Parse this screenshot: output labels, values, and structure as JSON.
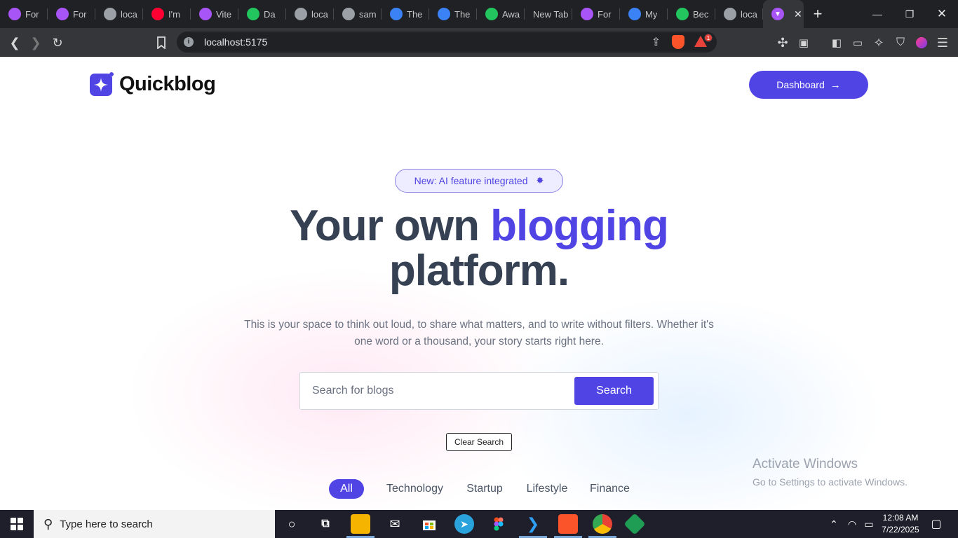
{
  "browser": {
    "tabs": [
      {
        "label": "For",
        "icon": "vite-icon",
        "color": "#a855f7"
      },
      {
        "label": "For",
        "icon": "vite-icon",
        "color": "#a855f7"
      },
      {
        "label": "loca",
        "icon": "globe-icon",
        "color": "#9aa0a6"
      },
      {
        "label": "I'm",
        "icon": "youtube-icon",
        "color": "#ff0033"
      },
      {
        "label": "Vite",
        "icon": "vite-icon",
        "color": "#a855f7"
      },
      {
        "label": "Da",
        "icon": "play-icon",
        "color": "#22c55e"
      },
      {
        "label": "loca",
        "icon": "globe-icon",
        "color": "#9aa0a6"
      },
      {
        "label": "sam",
        "icon": "globe-icon",
        "color": "#9aa0a6"
      },
      {
        "label": "The",
        "icon": "wordpress-icon",
        "color": "#3b82f6"
      },
      {
        "label": "The",
        "icon": "wordpress-icon",
        "color": "#3b82f6"
      },
      {
        "label": "Awa",
        "icon": "play-icon",
        "color": "#22c55e"
      },
      {
        "label": "New Tab",
        "icon": "",
        "color": ""
      },
      {
        "label": "For",
        "icon": "vite-icon",
        "color": "#a855f7"
      },
      {
        "label": "My",
        "icon": "wordpress-icon",
        "color": "#3b82f6"
      },
      {
        "label": "Bec",
        "icon": "bolt-icon",
        "color": "#22c55e"
      },
      {
        "label": "loca",
        "icon": "globe-icon",
        "color": "#9aa0a6"
      }
    ],
    "active_tab_icon": "vite-icon",
    "url": "localhost:5175",
    "rewards_badge": "1"
  },
  "site": {
    "logo_text": "Quickblog",
    "dashboard_label": "Dashboard",
    "dashboard_arrow": "→",
    "pill_text": "New: AI feature integrated",
    "pill_star": "✸",
    "headline_part1": "Your own ",
    "headline_accent": "blogging",
    "headline_part2": "platform.",
    "subtitle": "This is your space to think out loud, to share what matters, and to write without filters. Whether it's one word or a thousand, your story starts right here.",
    "search_placeholder": "Search for blogs",
    "search_button": "Search",
    "clear_button": "Clear Search",
    "categories": [
      "All",
      "Technology",
      "Startup",
      "Lifestyle",
      "Finance"
    ],
    "active_category": "All",
    "accent_color": "#5044e5"
  },
  "watermark": {
    "line1": "Activate Windows",
    "line2": "Go to Settings to activate Windows."
  },
  "taskbar": {
    "search_placeholder": "Type here to search",
    "time": "12:08 AM",
    "date": "7/22/2025"
  }
}
